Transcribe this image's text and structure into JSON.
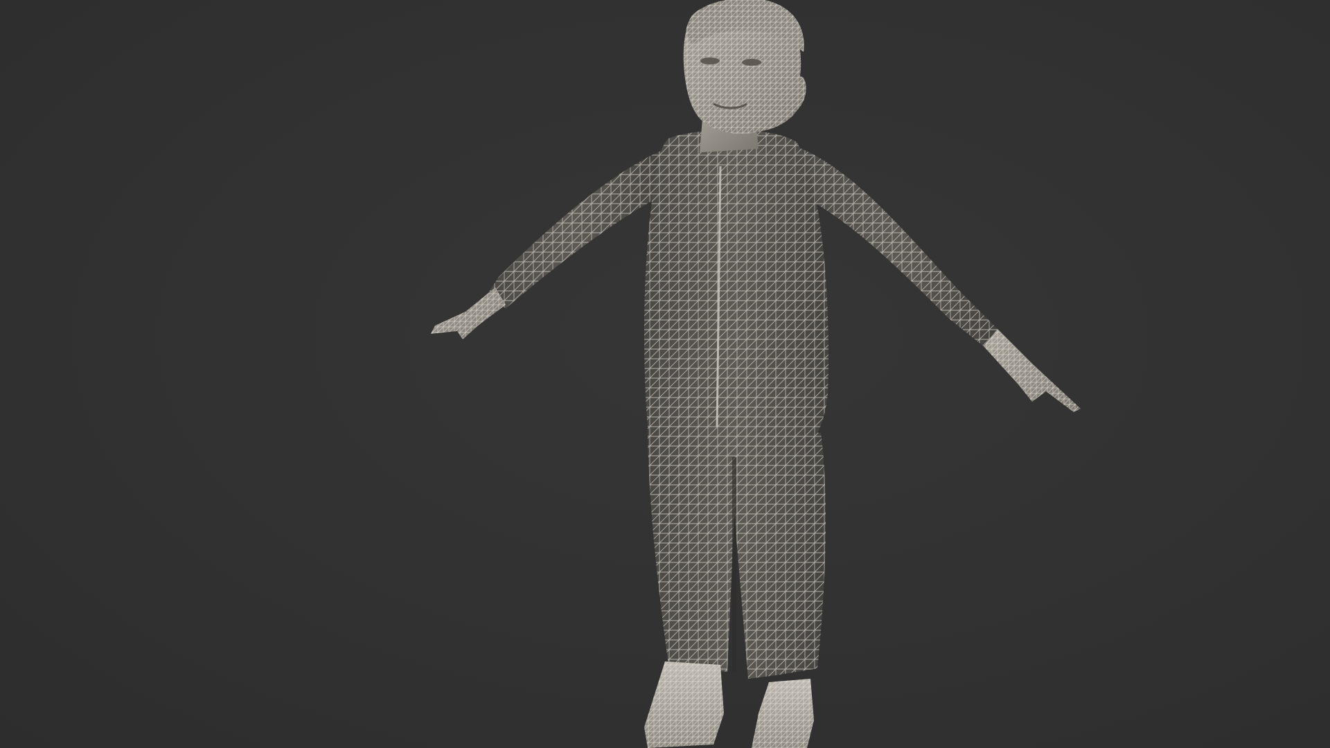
{
  "viewport": {
    "background_color": "#323232",
    "model_surface_color": "#8e8a82",
    "wireframe_color": "#d9d5cc",
    "shading": "wireframe-on-shaded",
    "subject": "character-model-t-pose"
  }
}
